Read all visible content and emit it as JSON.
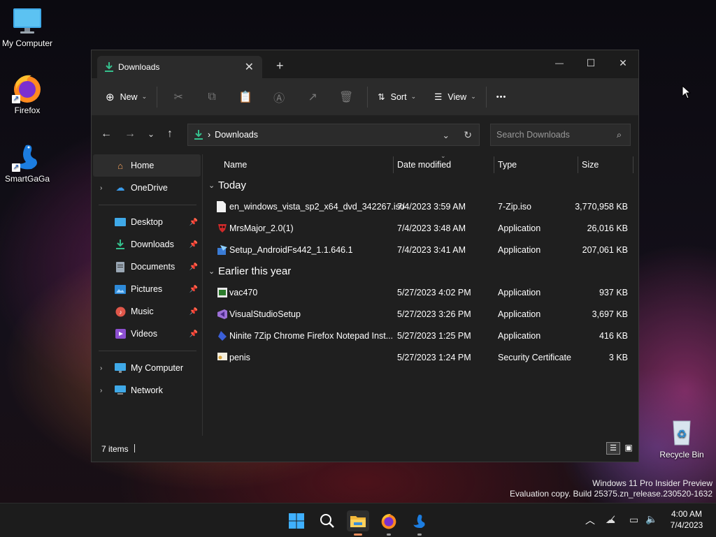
{
  "desktop": {
    "icons": [
      {
        "label": "My Computer",
        "icon": "monitor-icon"
      },
      {
        "label": "Firefox",
        "icon": "firefox-icon"
      },
      {
        "label": "SmartGaGa",
        "icon": "swan-icon"
      },
      {
        "label": "Recycle Bin",
        "icon": "recycle-bin-icon"
      }
    ],
    "watermark": {
      "line1": "Windows 11 Pro Insider Preview",
      "line2": "Evaluation copy. Build 25375.zn_release.230520-1632"
    }
  },
  "window": {
    "tab": {
      "title": "Downloads",
      "close": "✕"
    },
    "new_tab": "+",
    "controls": {
      "minimize": "—",
      "maximize": "☐",
      "close": "✕"
    },
    "toolbar": {
      "new_label": "New",
      "sort_label": "Sort",
      "view_label": "View",
      "more": "•••"
    },
    "address": {
      "separator": "›",
      "path": "Downloads",
      "search_placeholder": "Search Downloads"
    },
    "sidebar": {
      "top": [
        {
          "label": "Home",
          "icon": "home-icon",
          "selected": true
        },
        {
          "label": "OneDrive",
          "icon": "cloud-icon",
          "expandable": true
        }
      ],
      "pinned": [
        {
          "label": "Desktop",
          "icon": "desktop-folder-icon"
        },
        {
          "label": "Downloads",
          "icon": "download-icon"
        },
        {
          "label": "Documents",
          "icon": "documents-icon"
        },
        {
          "label": "Pictures",
          "icon": "pictures-icon"
        },
        {
          "label": "Music",
          "icon": "music-icon"
        },
        {
          "label": "Videos",
          "icon": "videos-icon"
        }
      ],
      "bottom": [
        {
          "label": "My Computer",
          "icon": "monitor-icon"
        },
        {
          "label": "Network",
          "icon": "network-icon"
        }
      ]
    },
    "columns": {
      "name": "Name",
      "date": "Date modified",
      "type": "Type",
      "size": "Size"
    },
    "groups": [
      {
        "title": "Today",
        "files": [
          {
            "name": "en_windows_vista_sp2_x64_dvd_342267.iso",
            "date": "7/4/2023 3:59 AM",
            "type": "7-Zip.iso",
            "size": "3,770,958 KB",
            "icon": "file-icon"
          },
          {
            "name": "MrsMajor_2.0(1)",
            "date": "7/4/2023 3:48 AM",
            "type": "Application",
            "size": "26,016 KB",
            "icon": "red-skull-icon"
          },
          {
            "name": "Setup_AndroidFs442_1.1.646.1",
            "date": "7/4/2023 3:41 AM",
            "type": "Application",
            "size": "207,061 KB",
            "icon": "installer-icon"
          }
        ]
      },
      {
        "title": "Earlier this year",
        "files": [
          {
            "name": "vac470",
            "date": "5/27/2023 4:02 PM",
            "type": "Application",
            "size": "937 KB",
            "icon": "app-icon"
          },
          {
            "name": "VisualStudioSetup",
            "date": "5/27/2023 3:26 PM",
            "type": "Application",
            "size": "3,697 KB",
            "icon": "visual-studio-icon"
          },
          {
            "name": "Ninite 7Zip Chrome Firefox Notepad Inst...",
            "date": "5/27/2023 1:25 PM",
            "type": "Application",
            "size": "416 KB",
            "icon": "ninite-icon"
          },
          {
            "name": "penis",
            "date": "5/27/2023 1:24 PM",
            "type": "Security Certificate",
            "size": "3 KB",
            "icon": "certificate-icon"
          }
        ]
      }
    ],
    "status": {
      "items": "7 items"
    }
  },
  "taskbar": {
    "clock": {
      "time": "4:00 AM",
      "date": "7/4/2023"
    }
  }
}
